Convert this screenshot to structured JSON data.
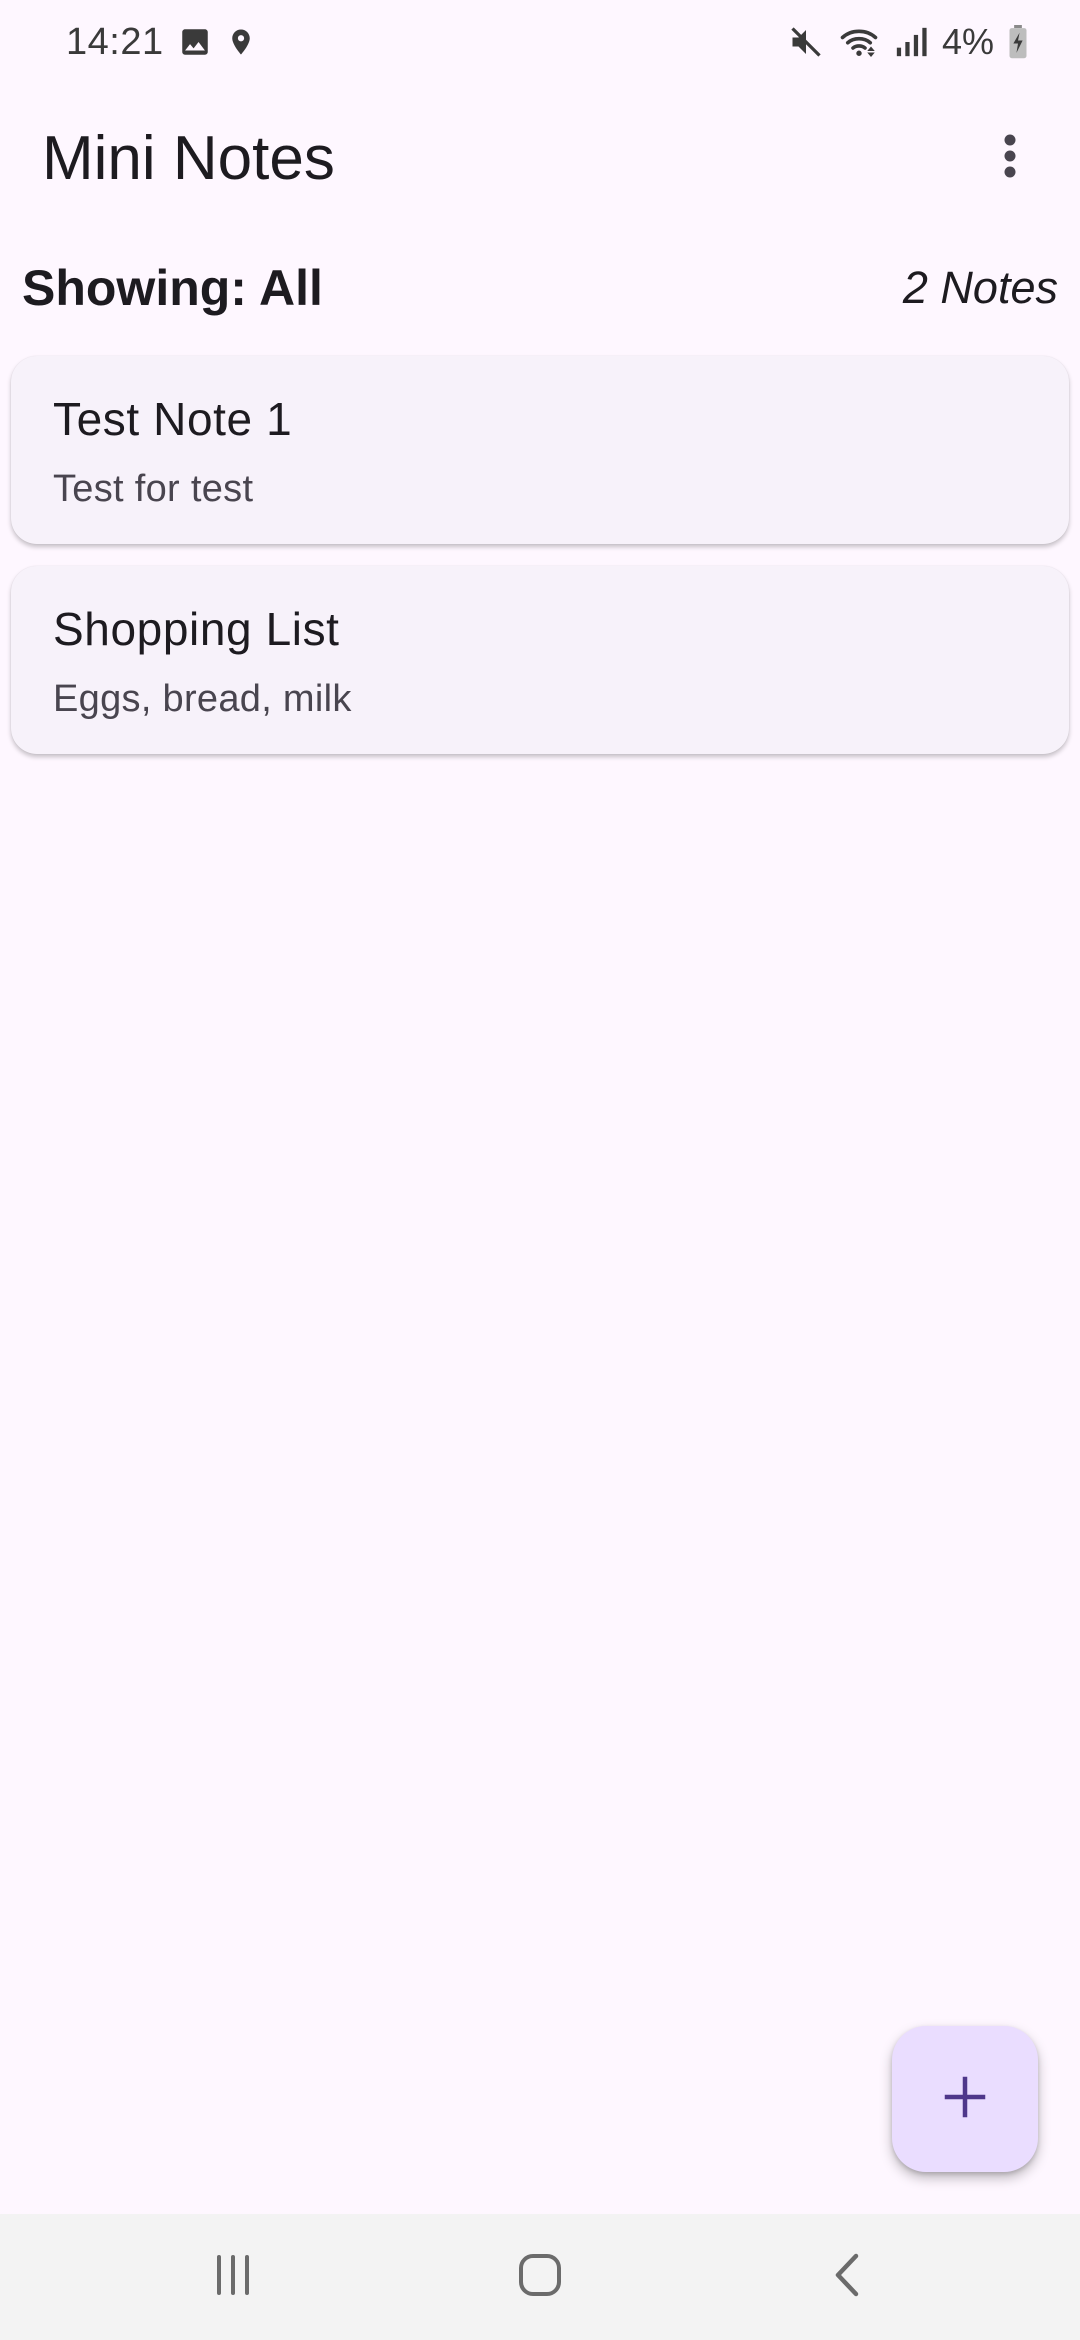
{
  "status_bar": {
    "time": "14:21",
    "battery_percent": "4%",
    "icons": [
      "gallery-icon",
      "location-icon",
      "mute-icon",
      "wifi-icon",
      "signal-icon",
      "battery-charging-icon"
    ]
  },
  "app_bar": {
    "title": "Mini Notes",
    "overflow_icon": "more-vert-icon"
  },
  "filter": {
    "label": "Showing: All",
    "count": "2 Notes"
  },
  "notes": [
    {
      "title": "Test Note 1",
      "body": "Test for test"
    },
    {
      "title": "Shopping List",
      "body": "Eggs, bread, milk"
    }
  ],
  "fab": {
    "icon": "add-icon"
  },
  "nav_bar": {
    "buttons": [
      "recents-icon",
      "home-icon",
      "back-icon"
    ]
  },
  "colors": {
    "background": "#FEF7FF",
    "card": "#F7F2FA",
    "fab": "#EADDFF",
    "fab_icon": "#4F378B",
    "nav_bar": "#F3F3F3"
  }
}
